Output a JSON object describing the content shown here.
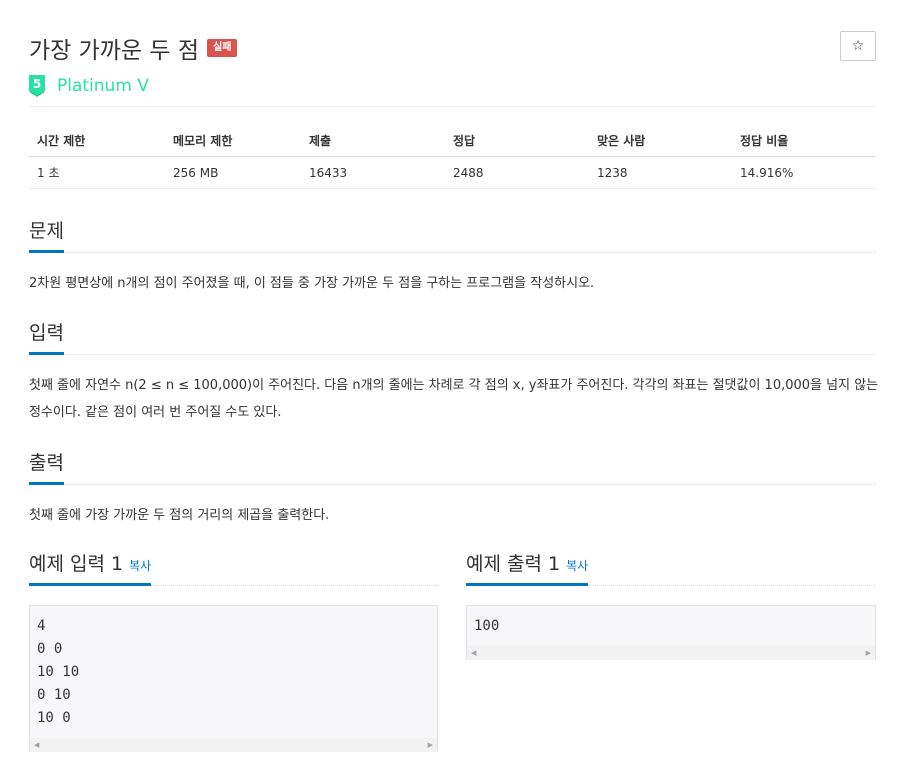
{
  "problem": {
    "title": "가장 가까운 두 점",
    "status_badge": "실패",
    "star_icon": "☆",
    "tier": {
      "number": "5",
      "label": "Platinum V",
      "color": "#27e2a4"
    }
  },
  "stats": {
    "headers": [
      "시간 제한",
      "메모리 제한",
      "제출",
      "정답",
      "맞은 사람",
      "정답 비율"
    ],
    "values": [
      "1 초",
      "256 MB",
      "16433",
      "2488",
      "1238",
      "14.916%"
    ]
  },
  "sections": {
    "problem": {
      "title": "문제",
      "text": "2차원 평면상에 n개의 점이 주어졌을 때, 이 점들 중 가장 가까운 두 점을 구하는 프로그램을 작성하시오."
    },
    "input": {
      "title": "입력",
      "text": "첫째 줄에 자연수 n(2 ≤ n ≤ 100,000)이 주어진다. 다음 n개의 줄에는 차례로 각 점의 x, y좌표가 주어진다. 각각의 좌표는 절댓값이 10,000을 넘지 않는 정수이다. 같은 점이 여러 번 주어질 수도 있다."
    },
    "output": {
      "title": "출력",
      "text": "첫째 줄에 가장 가까운 두 점의 거리의 제곱을 출력한다."
    }
  },
  "samples": {
    "input": {
      "title": "예제 입력 1",
      "copy_label": "복사",
      "content": "4\n0 0\n10 10\n0 10\n10 0"
    },
    "output": {
      "title": "예제 출력 1",
      "copy_label": "복사",
      "content": "100"
    }
  },
  "colors": {
    "accent": "#0076c0",
    "badge": "#d9534f",
    "tier": "#27e2a4"
  }
}
